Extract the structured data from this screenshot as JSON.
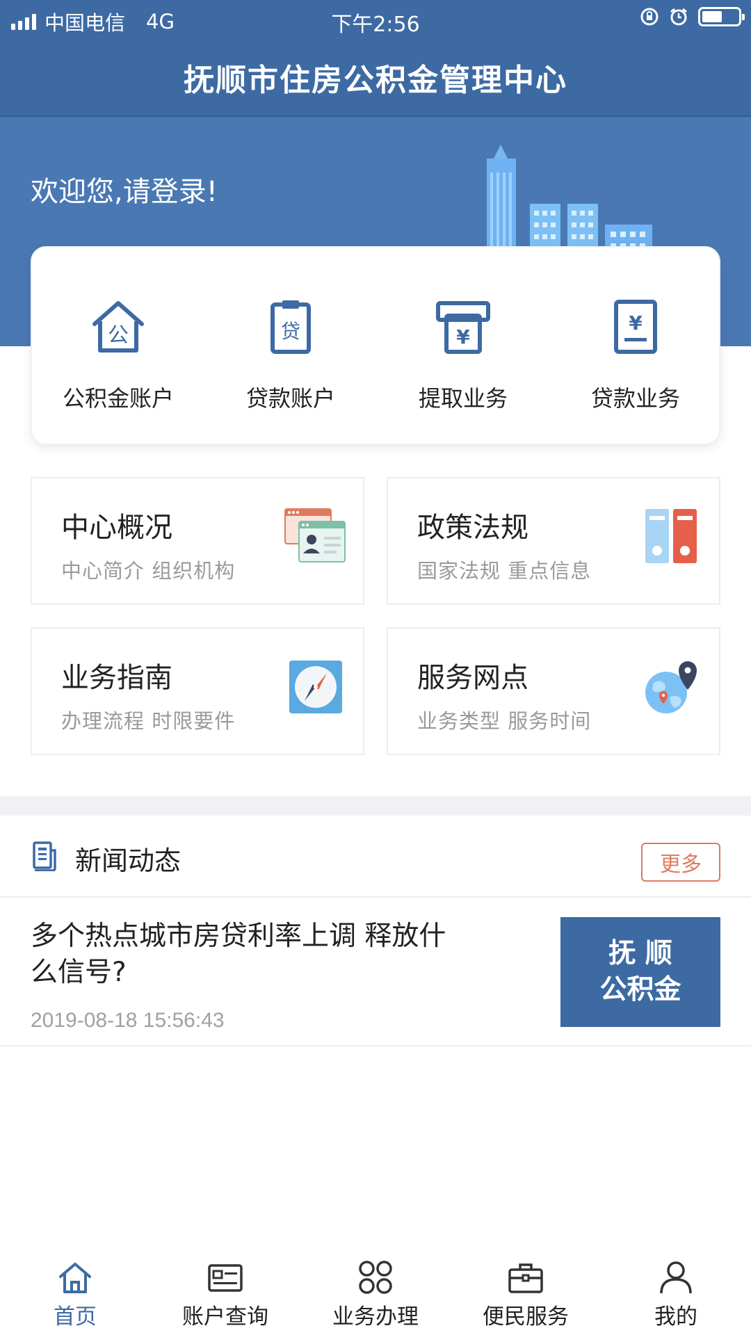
{
  "status_bar": {
    "carrier": "中国电信",
    "network": "4G",
    "time": "下午2:56",
    "battery_level": 0.55
  },
  "header": {
    "title": "抚顺市住房公积金管理中心"
  },
  "banner": {
    "welcome": "欢迎您,请登录!"
  },
  "quick_actions": [
    {
      "label": "公积金账户",
      "icon": "house-icon",
      "glyph": "公"
    },
    {
      "label": "贷款账户",
      "icon": "clipboard-icon",
      "glyph": "贷"
    },
    {
      "label": "提取业务",
      "icon": "atm-icon",
      "glyph": "¥"
    },
    {
      "label": "贷款业务",
      "icon": "receipt-icon",
      "glyph": "¥"
    }
  ],
  "grid": [
    {
      "title": "中心概况",
      "subtitle": "中心简介 组织机构",
      "icon": "profile-browser-icon"
    },
    {
      "title": "政策法规",
      "subtitle": "国家法规 重点信息",
      "icon": "binders-icon"
    },
    {
      "title": "业务指南",
      "subtitle": "办理流程 时限要件",
      "icon": "compass-icon"
    },
    {
      "title": "服务网点",
      "subtitle": "业务类型 服务时间",
      "icon": "globe-pin-icon"
    }
  ],
  "news": {
    "title": "新闻动态",
    "more_label": "更多",
    "items": [
      {
        "headline": "多个热点城市房贷利率上调 释放什么信号?",
        "date": "2019-08-18 15:56:43",
        "thumb_line1": "抚 顺",
        "thumb_line2": "公积金"
      }
    ]
  },
  "tabs": [
    {
      "label": "首页",
      "icon": "home-icon",
      "active": true
    },
    {
      "label": "账户查询",
      "icon": "id-card-icon",
      "active": false
    },
    {
      "label": "业务办理",
      "icon": "grid-icon",
      "active": false
    },
    {
      "label": "便民服务",
      "icon": "briefcase-icon",
      "active": false
    },
    {
      "label": "我的",
      "icon": "user-icon",
      "active": false
    }
  ],
  "colors": {
    "brand_blue": "#3d6aa3",
    "banner_blue": "#4a78b3",
    "accent_orange": "#e07a5f"
  }
}
